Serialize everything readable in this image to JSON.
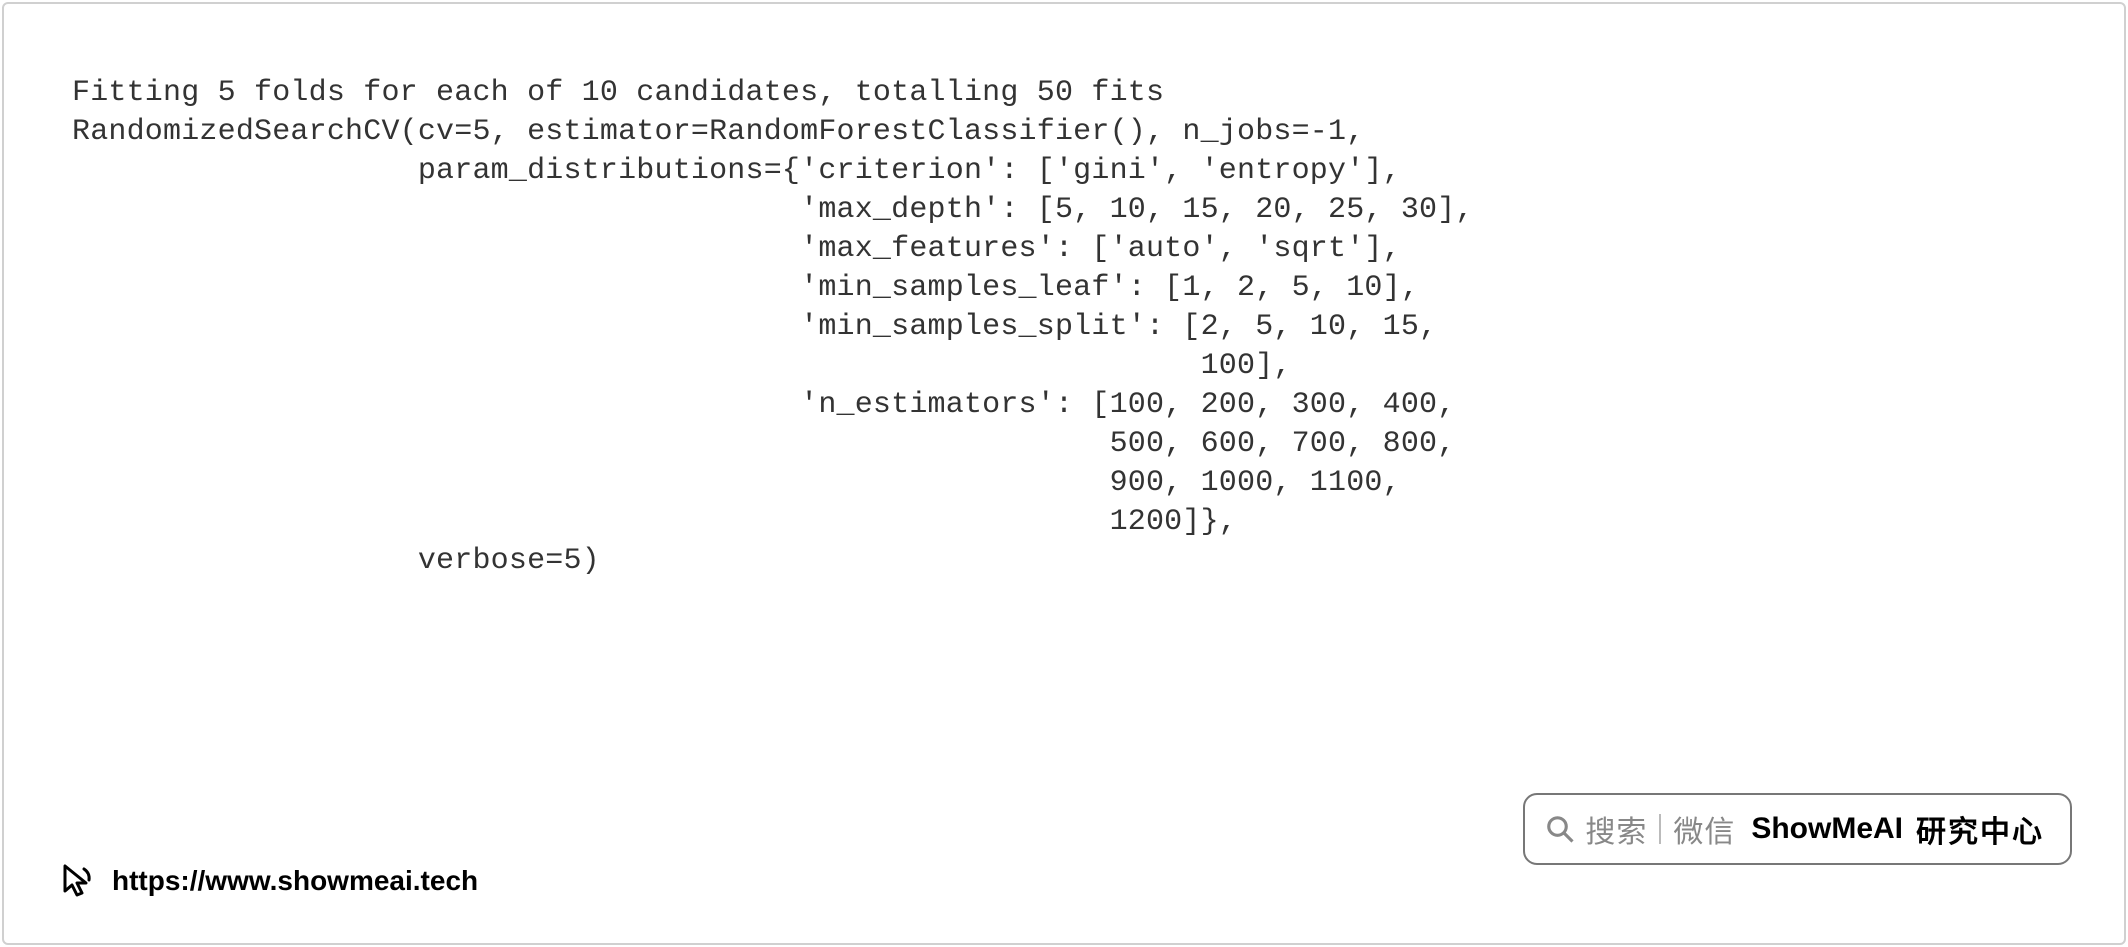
{
  "code": {
    "line1": "Fitting 5 folds for each of 10 candidates, totalling 50 fits",
    "line2": "RandomizedSearchCV(cv=5, estimator=RandomForestClassifier(), n_jobs=-1,",
    "line3": "                   param_distributions={'criterion': ['gini', 'entropy'],",
    "line4": "                                        'max_depth': [5, 10, 15, 20, 25, 30],",
    "line5": "                                        'max_features': ['auto', 'sqrt'],",
    "line6": "                                        'min_samples_leaf': [1, 2, 5, 10],",
    "line7": "                                        'min_samples_split': [2, 5, 10, 15,",
    "line8": "                                                              100],",
    "line9": "                                        'n_estimators': [100, 200, 300, 400,",
    "line10": "                                                         500, 600, 700, 800,",
    "line11": "                                                         900, 1000, 1100,",
    "line12": "                                                         1200]},",
    "line13": "                   verbose=5)"
  },
  "footer": {
    "url": "https://www.showmeai.tech"
  },
  "badge": {
    "search": "搜索",
    "wechat": "微信",
    "brand_en": "ShowMeAI",
    "brand_cn": "研究中心"
  }
}
